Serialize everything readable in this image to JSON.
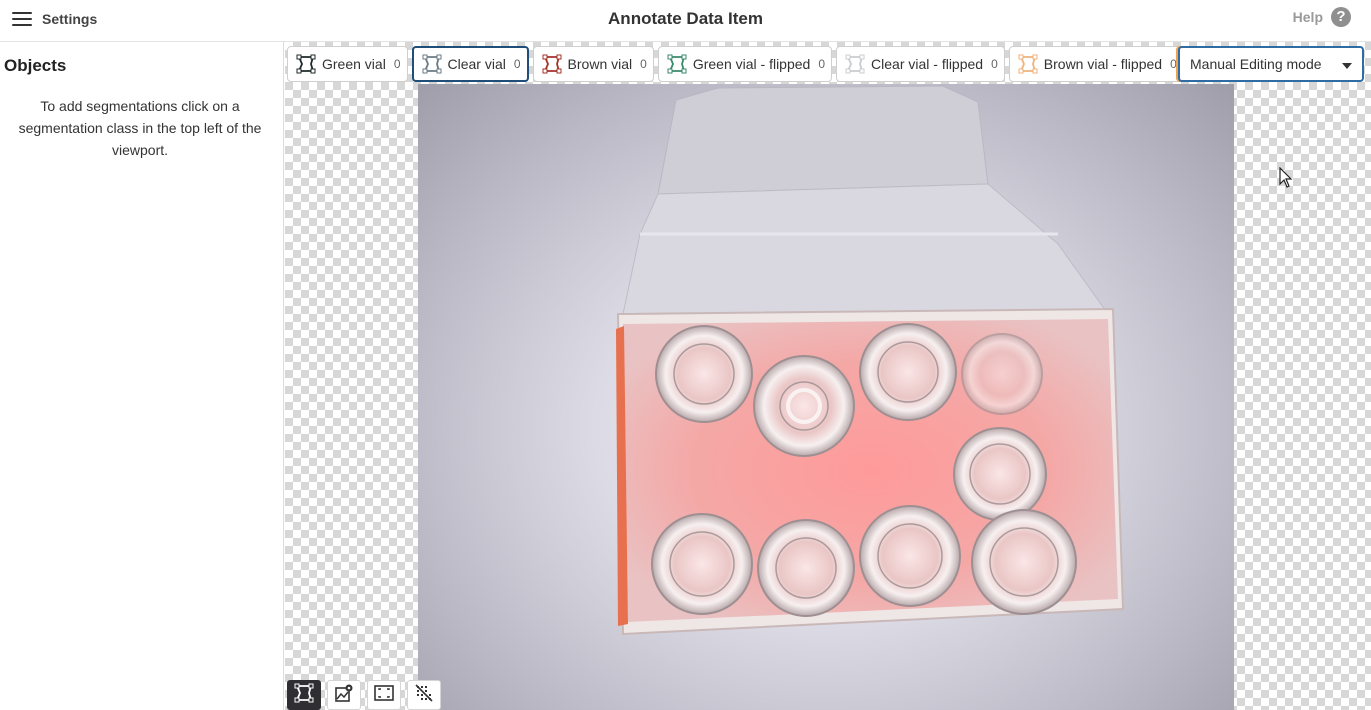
{
  "header": {
    "menu_label": "Settings",
    "title": "Annotate Data Item",
    "help_label": "Help",
    "help_icon": "?"
  },
  "sidebar": {
    "title": "Objects",
    "hint": "To add segmentations click on a segmentation class in the top left of the viewport."
  },
  "classes": [
    {
      "label": "Green vial",
      "count": "0",
      "color": "#1e2a2a"
    },
    {
      "label": "Clear vial",
      "count": "0",
      "color": "#6b7b86",
      "active": true
    },
    {
      "label": "Brown vial",
      "count": "0",
      "color": "#a3312a"
    },
    {
      "label": "Green vial - flipped",
      "count": "0",
      "color": "#3a8a6a"
    },
    {
      "label": "Clear vial - flipped",
      "count": "0",
      "color": "#c9ccd1"
    },
    {
      "label": "Brown vial - flipped",
      "count": "0",
      "color": "#f0b27a"
    }
  ],
  "mode_select": {
    "value": "Manual Editing mode"
  },
  "bottom_tools": [
    "polygon-tool-icon",
    "image-settings-icon",
    "bounding-box-icon",
    "clear-mask-icon"
  ]
}
